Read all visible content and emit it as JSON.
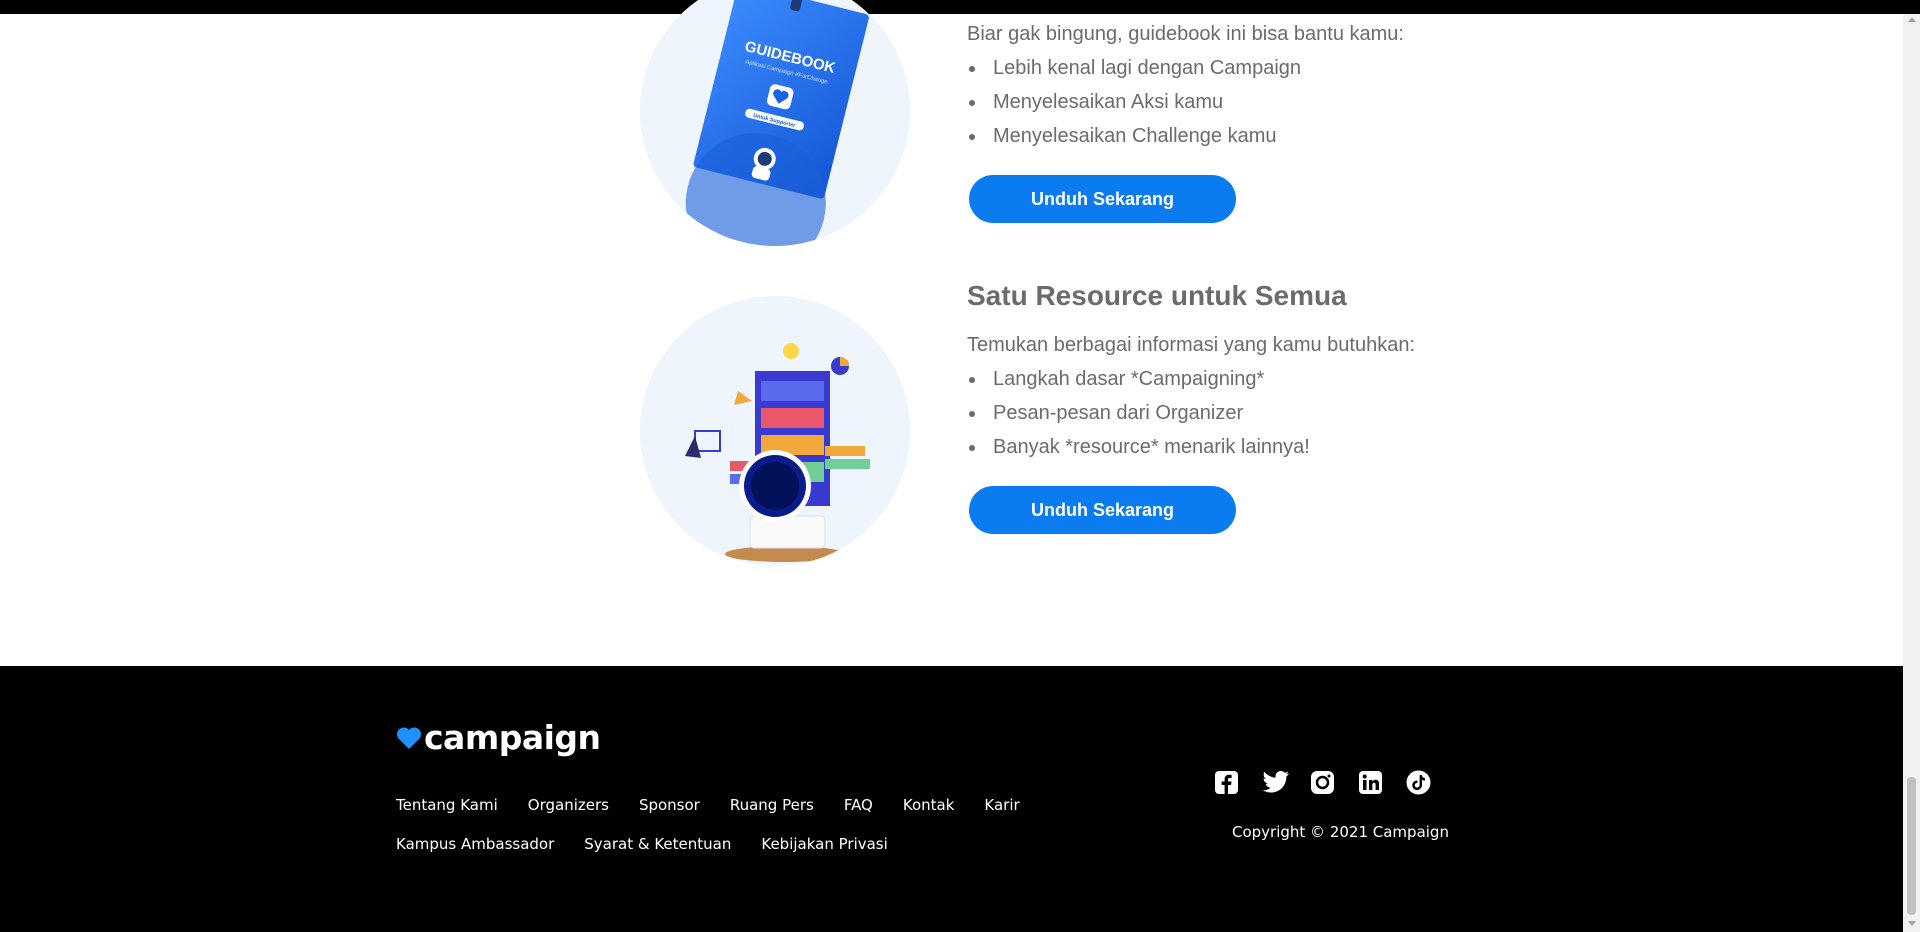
{
  "guidebook": {
    "intro": "Biar gak bingung, guidebook ini bisa bantu kamu:",
    "items": [
      "Lebih kenal lagi dengan Campaign",
      "Menyelesaikan Aksi kamu",
      "Menyelesaikan Challenge kamu"
    ],
    "button_label": "Unduh Sekarang",
    "illustration_title": "GUIDEBOOK",
    "illustration_subtitle": "Aplikasi Campaign #ForChange",
    "illustration_badge": "Untuk Supporter"
  },
  "resource": {
    "title": "Satu Resource untuk Semua",
    "intro": "Temukan berbagai informasi yang kamu butuhkan:",
    "items": [
      "Langkah dasar *Campaigning*",
      "Pesan-pesan dari Organizer",
      "Banyak *resource* menarik lainnya!"
    ],
    "button_label": "Unduh Sekarang"
  },
  "footer": {
    "logo_text": "campaign",
    "links_row1": [
      "Tentang Kami",
      "Organizers",
      "Sponsor",
      "Ruang Pers",
      "FAQ",
      "Kontak",
      "Karir"
    ],
    "links_row2": [
      "Kampus Ambassador",
      "Syarat & Ketentuan",
      "Kebijakan Privasi"
    ],
    "social_icons": [
      "facebook-icon",
      "twitter-icon",
      "instagram-icon",
      "linkedin-icon",
      "tiktok-icon"
    ],
    "copyright": "Copyright © 2021 Campaign"
  },
  "colors": {
    "accent": "#0a7cf0",
    "text": "#6b6b6b",
    "footer_bg": "#000000",
    "illustration_bg": "#eef5fd"
  }
}
